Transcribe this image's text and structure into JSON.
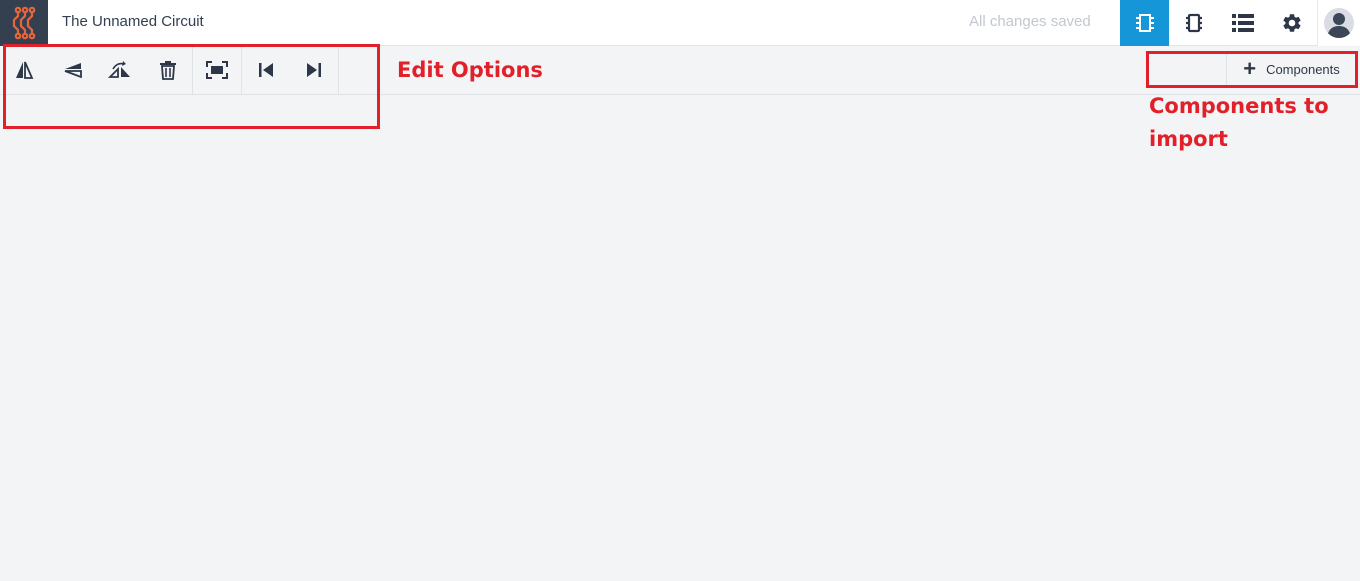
{
  "app": {
    "title": "The Unnamed Circuit",
    "save_status": "All changes saved"
  },
  "topbar": {
    "buttons": [
      {
        "icon": "chip-icon",
        "active": true
      },
      {
        "icon": "component-icon",
        "active": false
      },
      {
        "icon": "list-icon",
        "active": false
      },
      {
        "icon": "gear-icon",
        "active": false
      }
    ],
    "avatar_icon": "user-avatar-icon"
  },
  "toolbar": {
    "tools": [
      "flip-horizontal-icon",
      "flip-vertical-icon",
      "rotate-icon",
      "delete-icon",
      "fit-screen-icon",
      "undo-icon",
      "redo-icon"
    ]
  },
  "components_button": {
    "icon": "plus-icon",
    "label": "Components"
  },
  "annotations": {
    "edit_options": "Edit Options",
    "components_line1": "Components to",
    "components_line2": "import"
  },
  "colors": {
    "accent": "#1496d8",
    "logo_bg": "#34404f",
    "logo_fg": "#e8643c",
    "annotation": "#e2202a"
  }
}
